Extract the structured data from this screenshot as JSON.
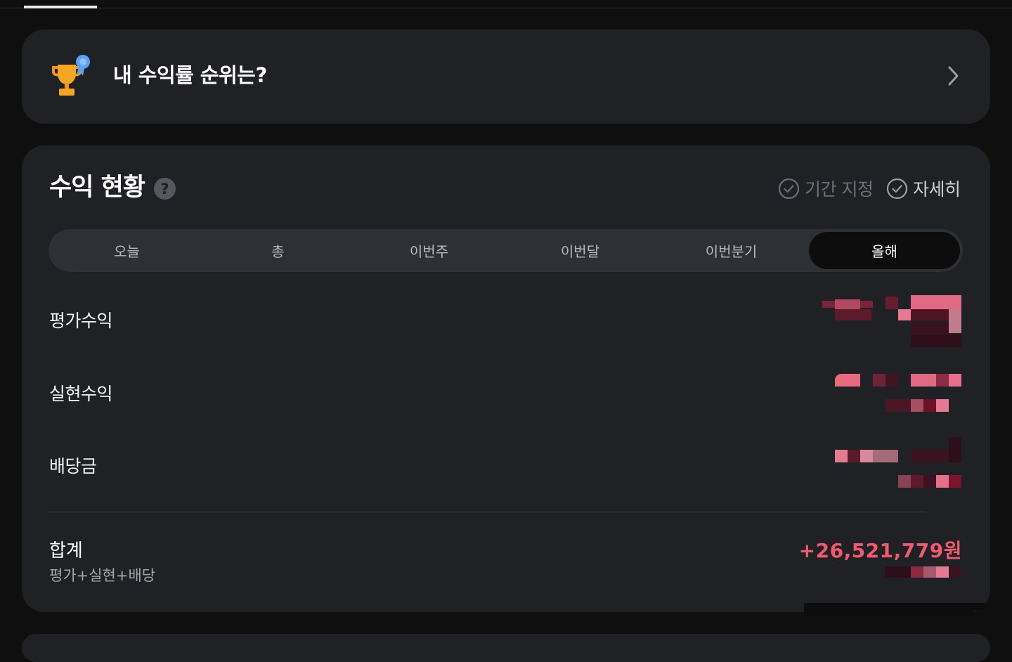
{
  "rank_banner": {
    "label": "내 수익률 순위는?",
    "icon": "trophy-icon",
    "arrow_icon": "chevron-right-icon"
  },
  "profit_status": {
    "title": "수익 현황",
    "help_icon": "question-icon",
    "period_button": "기간 지정",
    "detail_button": "자세히",
    "tabs": [
      {
        "label": "오늘",
        "active": false
      },
      {
        "label": "총",
        "active": false
      },
      {
        "label": "이번주",
        "active": false
      },
      {
        "label": "이번달",
        "active": false
      },
      {
        "label": "이번분기",
        "active": false
      },
      {
        "label": "올해",
        "active": true
      }
    ],
    "rows": [
      {
        "label": "평가수익"
      },
      {
        "label": "실현수익"
      },
      {
        "label": "배당금"
      }
    ],
    "total": {
      "label": "합계",
      "sub_label": "평가+실현+배당",
      "value": "+26,521,779원"
    }
  },
  "colors": {
    "background": "#0f0f10",
    "card": "#1f2124",
    "profit_red": "#ef5a6f",
    "tab_bg": "#2d3035",
    "tab_active": "#0d0d0e"
  }
}
